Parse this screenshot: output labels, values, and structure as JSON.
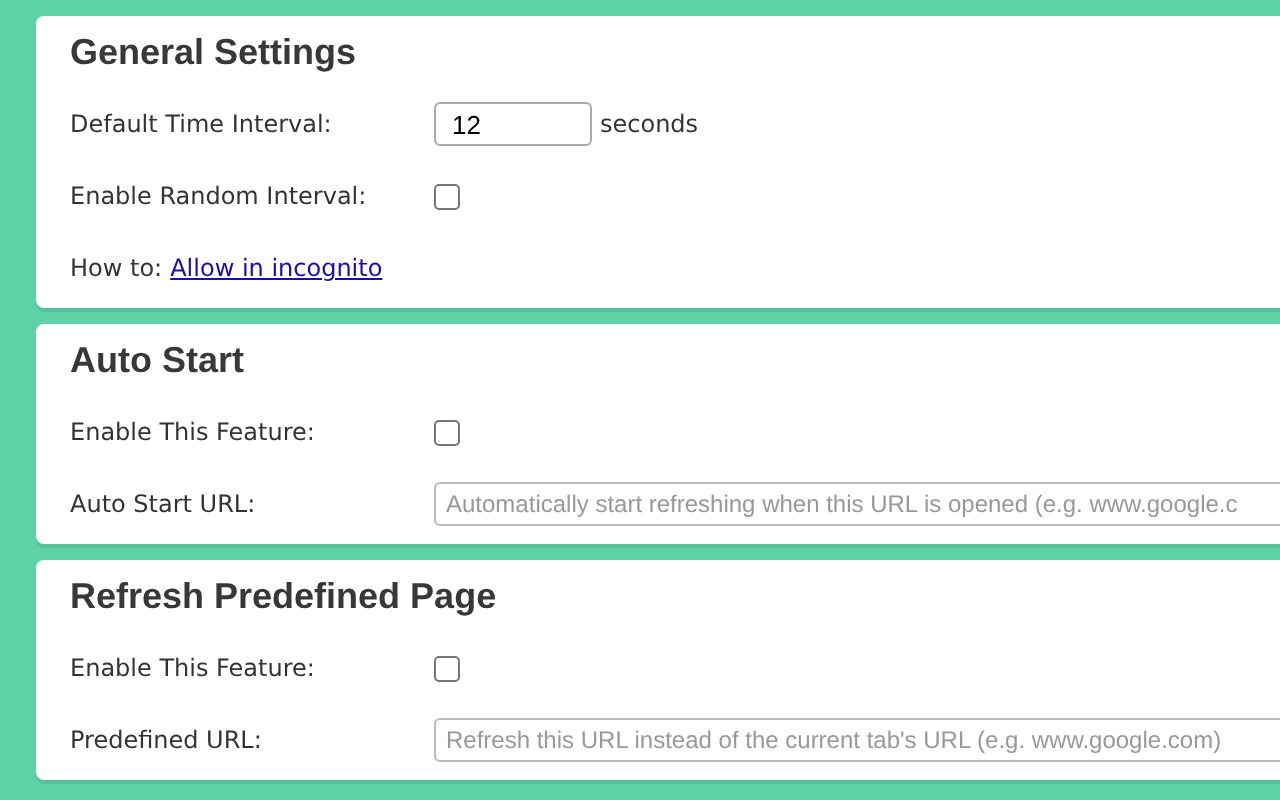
{
  "sections": [
    {
      "title": "General Settings",
      "rows": [
        {
          "kind": "number",
          "label": "Default Time Interval:",
          "value": "12",
          "suffix": "seconds"
        },
        {
          "kind": "checkbox",
          "label": "Enable Random Interval:",
          "checked": false
        },
        {
          "kind": "link",
          "label": "How to:",
          "link": "Allow in incognito"
        }
      ]
    },
    {
      "title": "Auto Start",
      "rows": [
        {
          "kind": "checkbox",
          "label": "Enable This Feature:",
          "checked": false
        },
        {
          "kind": "url",
          "label": "Auto Start URL:",
          "placeholder": "Automatically start refreshing when this URL is opened (e.g. www.google.c"
        }
      ]
    },
    {
      "title": "Refresh Predefined Page",
      "rows": [
        {
          "kind": "checkbox",
          "label": "Enable This Feature:",
          "checked": false
        },
        {
          "kind": "url",
          "label": "Predefined URL:",
          "placeholder": "Refresh this URL instead of the current tab's URL (e.g. www.google.com)"
        }
      ]
    }
  ]
}
